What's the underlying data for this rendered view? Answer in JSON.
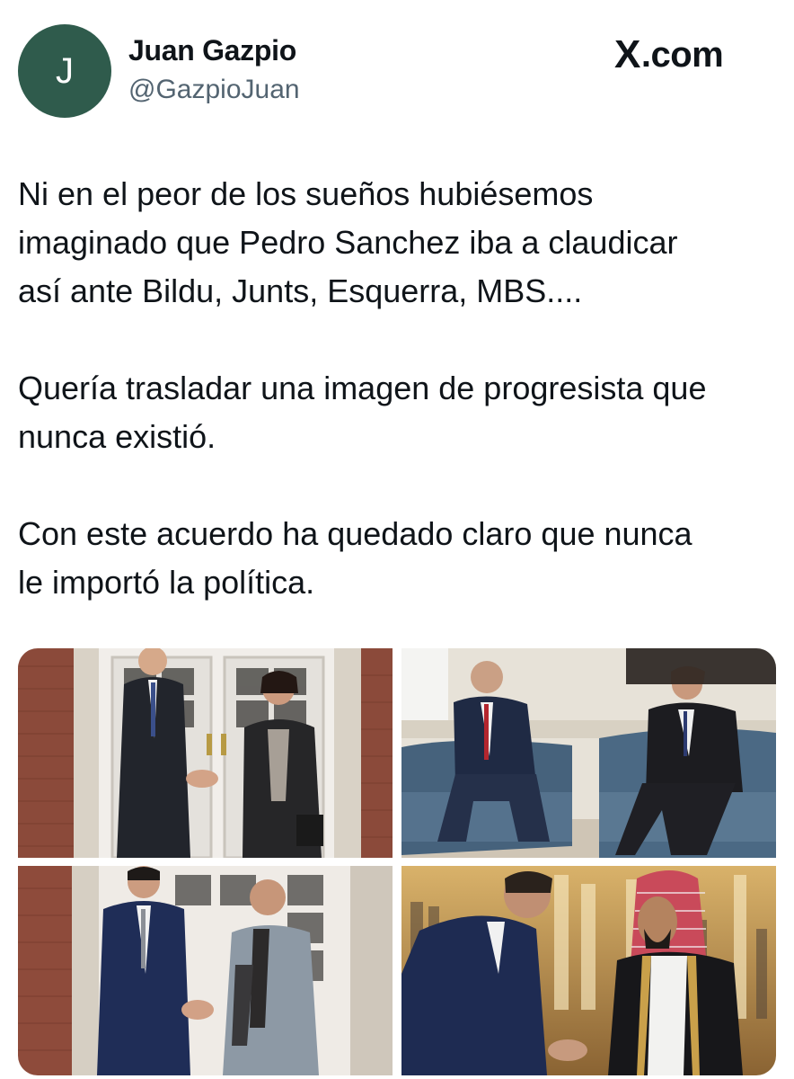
{
  "author": {
    "avatar_initial": "J",
    "display_name": "Juan Gazpio",
    "handle": "@GazpioJuan"
  },
  "brand": {
    "logo_glyph": "X",
    "label": ".com"
  },
  "tweet": {
    "paragraphs": [
      "Ni en el peor de los sueños hubiésemos\nimaginado que Pedro Sanchez iba a claudicar\nasí ante Bildu, Junts, Esquerra, MBS....",
      "Quería trasladar una imagen de progresista que\nnunca existió.",
      "Con este acuerdo ha quedado claro que nunca\nle importó la política."
    ]
  },
  "colors": {
    "avatar_bg": "#2f5b4c",
    "handle_text": "#536471",
    "text": "#0f1419"
  }
}
